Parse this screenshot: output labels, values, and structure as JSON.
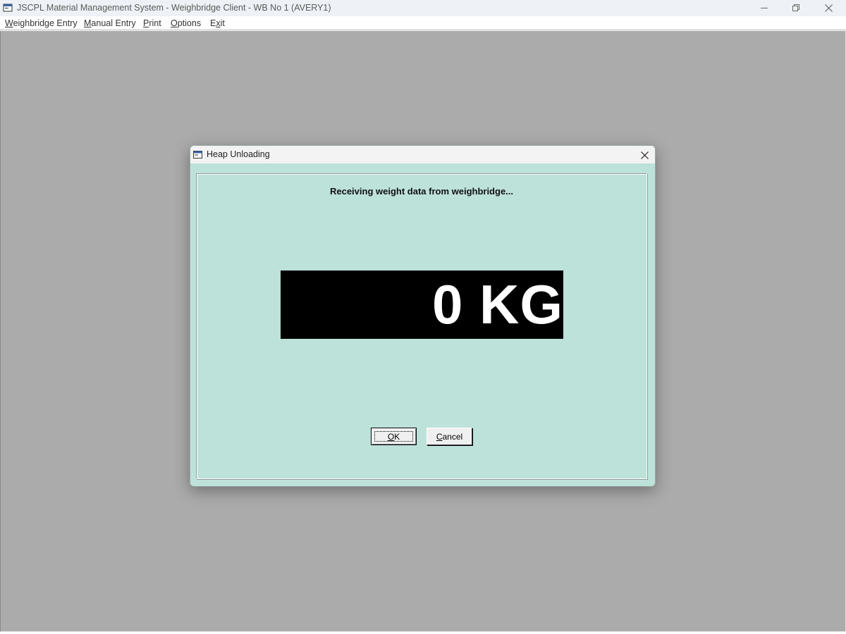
{
  "window": {
    "title": "JSCPL Material Management System - Weighbridge Client - WB No 1 (AVERY1)"
  },
  "menu": {
    "items": [
      {
        "mnemonic": "W",
        "rest": "eighbridge Entry"
      },
      {
        "mnemonic": "M",
        "rest": "anual Entry"
      },
      {
        "mnemonic": "P",
        "rest": "rint"
      },
      {
        "mnemonic": "O",
        "rest": "ptions"
      },
      {
        "pre": "E",
        "mnemonic": "x",
        "rest": "it"
      }
    ]
  },
  "dialog": {
    "title": "Heap Unloading",
    "status": "Receiving weight data from weighbridge...",
    "weight_display": "0 KG",
    "ok_button": {
      "mnemonic": "O",
      "rest": "K"
    },
    "cancel_button": {
      "label": "Cancel"
    }
  },
  "colors": {
    "dialog_bg": "#bde2da",
    "mdi_bg": "#ababab",
    "display_bg": "#000000",
    "display_fg": "#ffffff"
  }
}
